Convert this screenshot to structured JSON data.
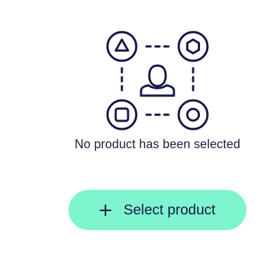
{
  "empty_state": {
    "illustration_icon": "product-selection-illustration",
    "message": "No product has been selected"
  },
  "select_button": {
    "icon": "plus-icon",
    "label": "Select product"
  },
  "colors": {
    "accent": "#7ff5cf",
    "ink": "#1a1848",
    "text": "#1f1d3a",
    "background": "#ffffff"
  }
}
